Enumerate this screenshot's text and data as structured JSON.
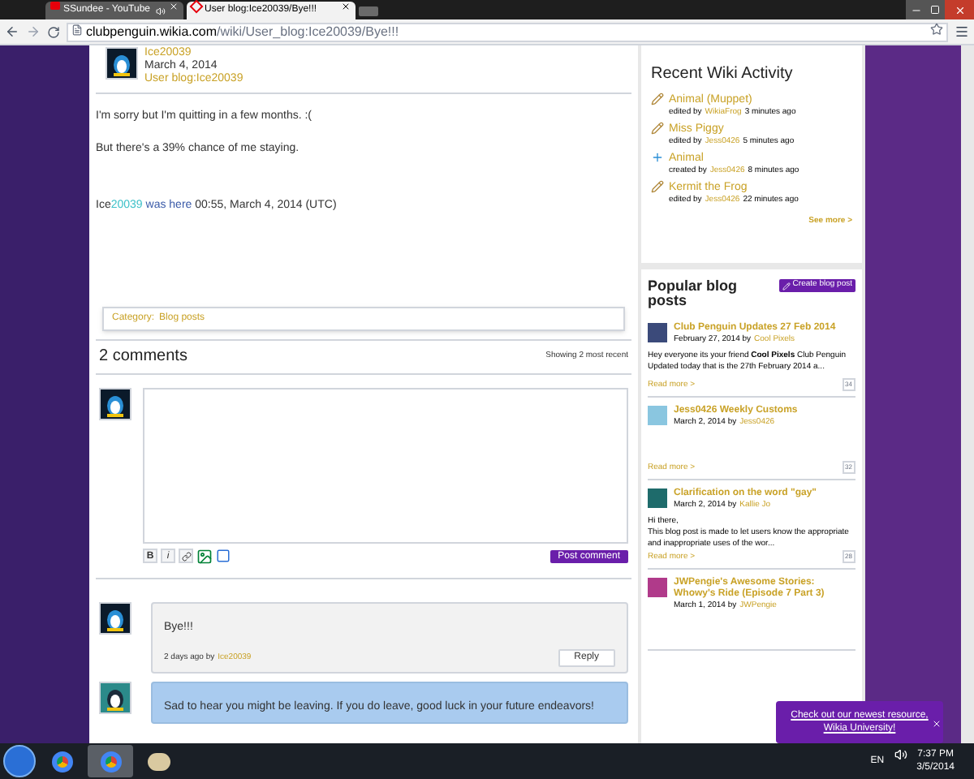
{
  "browser": {
    "tabs": [
      {
        "title": "SSundee - YouTube",
        "kind": "youtube",
        "audio": true,
        "selected": false
      },
      {
        "title": "User blog:Ice20039/Bye!!!",
        "kind": "wikia",
        "audio": false,
        "selected": true
      }
    ],
    "address": {
      "host": "clubpenguin.wikia.com",
      "path": "/wiki/User_blog:Ice20039/Bye!!!"
    }
  },
  "post": {
    "author": "Ice20039",
    "date": "March 4, 2014",
    "blog_link": "User blog:Ice20039",
    "paragraphs": [
      "I'm sorry but I'm quitting in a few months. :(",
      "But there's a 39% chance of me staying."
    ],
    "signature": {
      "user": "Ice",
      "user_number": "20039",
      "link": "was here",
      "time": "00:55, March 4, 2014 (UTC)"
    },
    "category_label": "Category:",
    "category": "Blog posts"
  },
  "comments": {
    "heading": "2 comments",
    "showing": "Showing 2 most recent",
    "post_button": "Post comment",
    "toolbar": [
      "B",
      "i"
    ],
    "items": [
      {
        "text": "Bye!!!",
        "meta": "2 days ago by",
        "user": "Ice20039",
        "reply": "Reply",
        "highlighted": false
      },
      {
        "text": "Sad to hear you might be leaving. If you do leave, good luck in your future endeavors!",
        "highlighted": true
      }
    ]
  },
  "activity": {
    "title": "Recent Wiki Activity",
    "see_more": "See more >",
    "items": [
      {
        "kind": "edit",
        "title": "Animal (Muppet)",
        "action": "edited by",
        "user": "WikiaFrog",
        "time": "3 minutes ago"
      },
      {
        "kind": "edit",
        "title": "Miss Piggy",
        "action": "edited by",
        "user": "Jess0426",
        "time": "5 minutes ago"
      },
      {
        "kind": "create",
        "title": "Animal",
        "action": "created by",
        "user": "Jess0426",
        "time": "8 minutes ago"
      },
      {
        "kind": "edit",
        "title": "Kermit the Frog",
        "action": "edited by",
        "user": "Jess0426",
        "time": "22 minutes ago"
      }
    ]
  },
  "blogs": {
    "title": "Popular blog posts",
    "create_button": "Create blog post",
    "items": [
      {
        "title": "Club Penguin Updates 27 Feb 2014",
        "date": "February 27, 2014 by",
        "author": "Cool Pixels",
        "excerpt": [
          "Hey everyone its your friend **Cool Pixels** Club Penguin Updated today that is the 27th February 2014 a..."
        ],
        "read_more": "Read more >",
        "count": "34"
      },
      {
        "title": "Jess0426 Weekly Customs",
        "date": "March 2, 2014 by",
        "author": "Jess0426",
        "read_more": "Read more >",
        "count": "32"
      },
      {
        "title": "Clarification on the word \"gay\"",
        "date": "March 2, 2014 by",
        "author": "Kallie Jo",
        "excerpt": [
          "Hi there,",
          "This blog post is made to let users know the appropriate and inappropriate uses of the wor..."
        ],
        "read_more": "Read more >",
        "count": "28"
      },
      {
        "title": "JWPengie's Awesome Stories: Whowy's Ride (Episode 7 Part 3)",
        "date": "March 1, 2014 by",
        "author": "JWPengie"
      }
    ]
  },
  "notification": {
    "lines": [
      "Check out our newest resource,",
      "Wikia University!"
    ]
  },
  "taskbar": {
    "items": [
      {
        "kind": "chrome",
        "active": false
      },
      {
        "kind": "chrome",
        "active": true
      },
      {
        "kind": "paint",
        "active": false
      }
    ],
    "language": "EN",
    "time": "7:37 PM",
    "date": "3/5/2014"
  }
}
